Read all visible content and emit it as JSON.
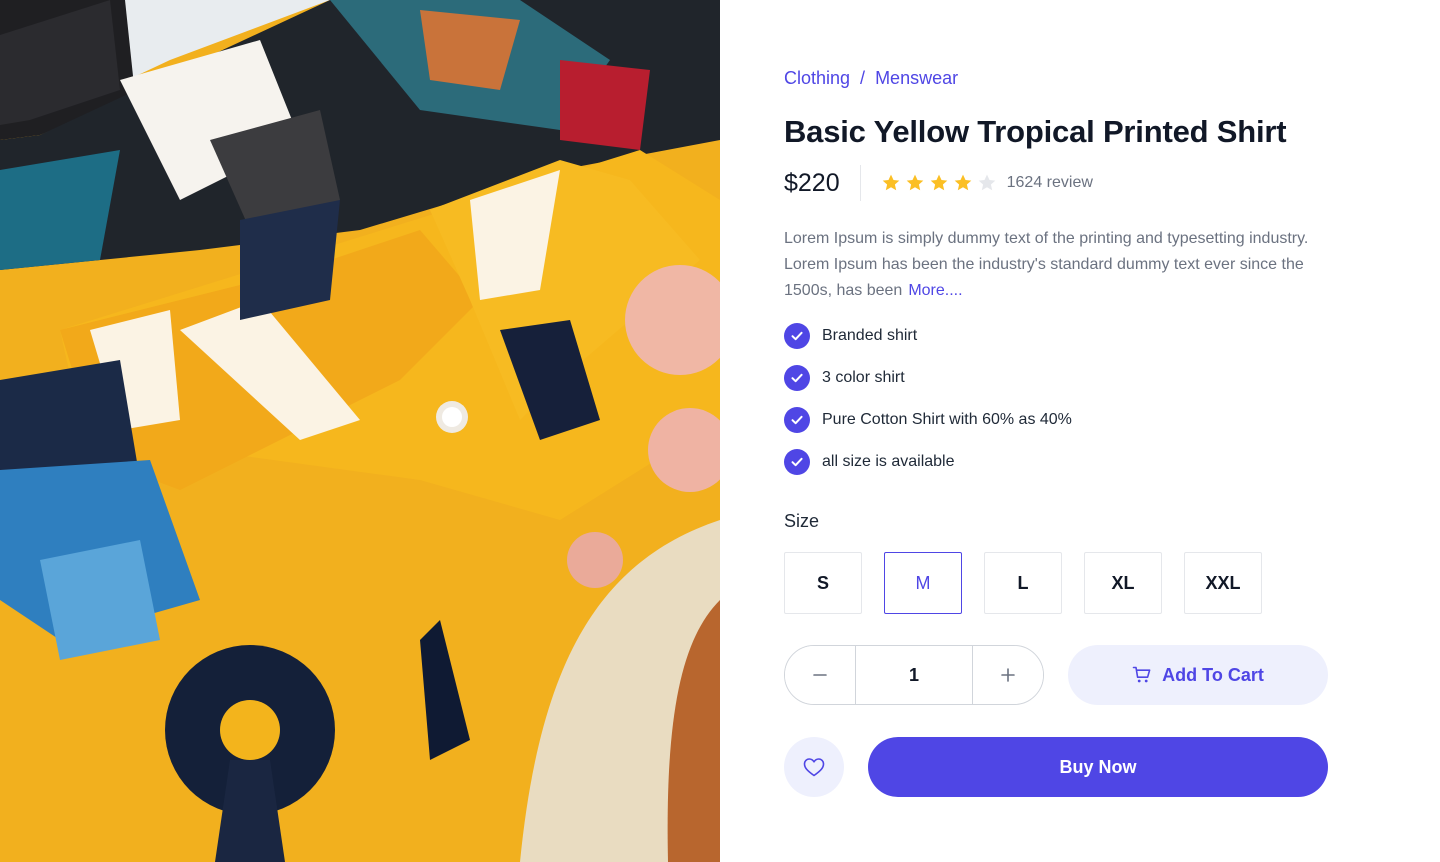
{
  "breadcrumb": {
    "items": [
      "Clothing",
      "Menswear"
    ],
    "separator": "/"
  },
  "product": {
    "title": "Basic Yellow Tropical Printed Shirt",
    "price": "$220",
    "rating": 4,
    "rating_max": 5,
    "review_count": "1624 review",
    "description": "Lorem Ipsum is simply dummy text of the printing and typesetting industry. Lorem Ipsum has been the industry's standard dummy text ever since the 1500s, has been",
    "more_link": "More....",
    "features": [
      "Branded shirt",
      "3 color shirt",
      "Pure Cotton Shirt with 60% as 40%",
      "all size is available"
    ]
  },
  "size": {
    "label": "Size",
    "options": [
      "S",
      "M",
      "L",
      "XL",
      "XXL"
    ],
    "selected": "M"
  },
  "quantity": {
    "value": "1"
  },
  "actions": {
    "add_to_cart": "Add To Cart",
    "buy_now": "Buy Now"
  },
  "colors": {
    "accent": "#4f46e5",
    "accent_light": "#eef0fd",
    "star_filled": "#fbbf24",
    "star_empty": "#e5e7eb",
    "shirt_yellow": "#f2b01e"
  },
  "icons": {
    "check": "check-icon",
    "minus": "minus-icon",
    "plus": "plus-icon",
    "cart": "cart-icon",
    "heart": "heart-icon",
    "star": "star-icon"
  }
}
